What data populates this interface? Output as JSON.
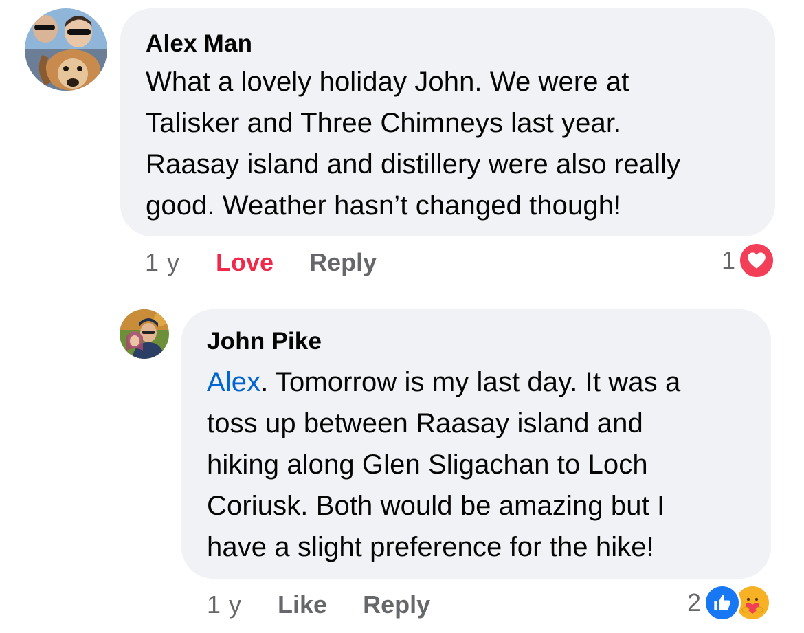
{
  "comments": [
    {
      "author": "Alex Man",
      "body_lines": [
        "What a lovely holiday John. We were at",
        "Talisker and Three Chimneys last year.",
        "Raasay island and distillery were also really",
        "good. Weather hasn’t changed though!"
      ],
      "time": "1 y",
      "reaction_label": "Love",
      "reply_label": "Reply",
      "reaction_count": "1",
      "reaction_icons": [
        "heart-love-icon"
      ],
      "colors": {
        "reaction_label": "#f02849",
        "heart": "#f33e58"
      }
    },
    {
      "author": "John Pike",
      "mention": "Alex",
      "body_first_rest": ". Tomorrow is my last day. It was a",
      "body_lines": [
        "toss up between Raasay island and",
        "hiking along Glen Sligachan to Loch",
        "Coriusk. Both would be amazing but I",
        "have a slight preference for the hike!"
      ],
      "time": "1 y",
      "reaction_label": "Like",
      "reply_label": "Reply",
      "reaction_count": "2",
      "reaction_icons": [
        "thumbs-up-like-icon",
        "care-hug-icon"
      ],
      "colors": {
        "mention": "#0064d1",
        "like": "#1877f2",
        "care": "#f7b125"
      }
    }
  ]
}
